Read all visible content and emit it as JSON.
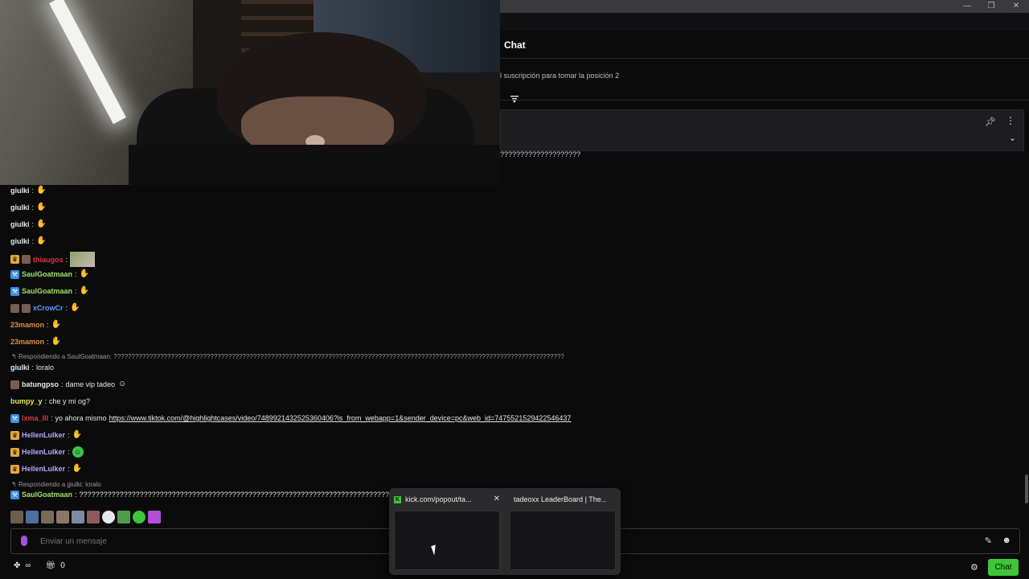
{
  "colors": {
    "accent": "#3ec53a",
    "background": "#0b0b0c",
    "badge_crown": "#e6a93a",
    "badge_tool": "#3b8de0"
  },
  "window": {
    "minimize": "—",
    "maximize": "❐",
    "close": "✕"
  },
  "chat": {
    "title": "Chat",
    "subscription_notice": "l suscripción para tomar la posición 2",
    "overflow_text": "????????????????????"
  },
  "messages": [
    {
      "user": "giulki",
      "color": "#e8e8e8",
      "badges": [],
      "text": "",
      "emote": "hands"
    },
    {
      "user": "giulki",
      "color": "#e8e8e8",
      "badges": [],
      "text": "",
      "emote": "hands"
    },
    {
      "user": "giulki",
      "color": "#e8e8e8",
      "badges": [],
      "text": "",
      "emote": "hands"
    },
    {
      "user": "giulki",
      "color": "#e8e8e8",
      "badges": [],
      "text": "",
      "emote": "hands"
    },
    {
      "user": "thiaugos",
      "color": "#d9363e",
      "badges": [
        "crown",
        "avatar"
      ],
      "text": "",
      "emote": "image"
    },
    {
      "user": "SaulGoatmaan",
      "color": "#9ee36b",
      "badges": [
        "tool"
      ],
      "text": "",
      "emote": "hands"
    },
    {
      "user": "SaulGoatmaan",
      "color": "#9ee36b",
      "badges": [
        "tool"
      ],
      "text": "",
      "emote": "hands"
    },
    {
      "user": "xCrowCr",
      "color": "#5d9bff",
      "badges": [
        "avatar",
        "avatar"
      ],
      "text": "",
      "emote": "hands"
    },
    {
      "user": "23mamon",
      "color": "#e0913c",
      "badges": [],
      "text": "",
      "emote": "hands"
    },
    {
      "user": "23mamon",
      "color": "#e0913c",
      "badges": [],
      "text": "",
      "emote": "hands"
    },
    {
      "user": "giulki",
      "color": "#e8e8e8",
      "badges": [],
      "text": "loralo",
      "emote": ""
    },
    {
      "user": "batungpso",
      "color": "#e8e8e8",
      "badges": [
        "avatar"
      ],
      "text": "dame vip tadeo",
      "emote": "face"
    },
    {
      "user": "bumpy_y",
      "color": "#e7e35a",
      "badges": [],
      "text": "che y mi og?",
      "emote": ""
    },
    {
      "user": "lxma_lll",
      "color": "#d9363e",
      "badges": [
        "tool"
      ],
      "text": "yo ahora mismo",
      "link": "https://www.tiktok.com/@highlightcases/video/7489921432525360406?is_from_webapp=1&sender_device=pc&web_id=7475521529422546437",
      "emote": ""
    },
    {
      "user": "HellenLulker",
      "color": "#b9a6ff",
      "badges": [
        "crown"
      ],
      "text": "",
      "emote": "hands"
    },
    {
      "user": "HellenLulker",
      "color": "#b9a6ff",
      "badges": [
        "crown"
      ],
      "text": "",
      "emote": "green"
    },
    {
      "user": "HellenLulker",
      "color": "#b9a6ff",
      "badges": [
        "crown"
      ],
      "text": "",
      "emote": "hands"
    },
    {
      "user": "SaulGoatmaan",
      "color": "#9ee36b",
      "badges": [
        "tool"
      ],
      "text": "??????????????????????????????????????????????????????????????????????????????",
      "emote": ""
    }
  ],
  "replies": {
    "reply1": "Respondiendo a SaulGoatmaan: ??????????????????????????????????????????????????????????????????????????????????????????????????????????????????????????????",
    "reply2": "Respondiendo a giulki: loralo"
  },
  "input": {
    "placeholder": "Enviar un mensaje"
  },
  "bottom": {
    "points": "∞",
    "gift_count": "0",
    "chat_button": "Chat"
  },
  "switcher": {
    "win1_title": "kick.com/popout/ta...",
    "win2_title": "tadeoxx LeaderBoard | The..."
  }
}
